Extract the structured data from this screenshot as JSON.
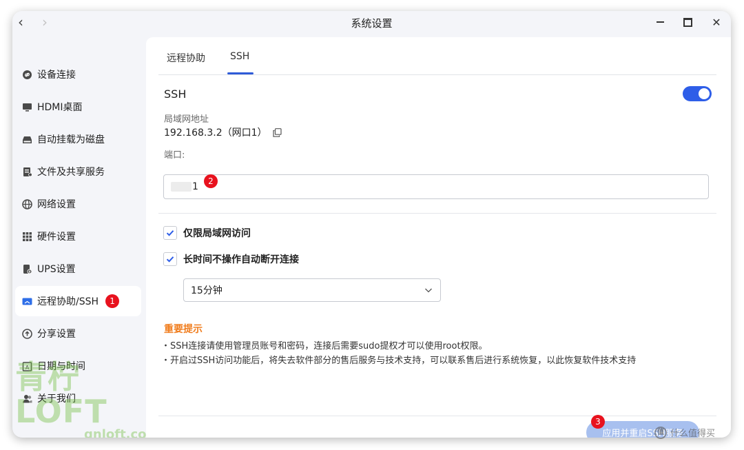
{
  "window": {
    "title": "系统设置"
  },
  "sidebar": {
    "items": [
      {
        "label": "设备连接",
        "icon": "link-icon"
      },
      {
        "label": "HDMI桌面",
        "icon": "monitor-icon"
      },
      {
        "label": "自动挂载为磁盘",
        "icon": "drive-icon"
      },
      {
        "label": "文件及共享服务",
        "icon": "file-share-icon"
      },
      {
        "label": "网络设置",
        "icon": "globe-icon"
      },
      {
        "label": "硬件设置",
        "icon": "grid-icon"
      },
      {
        "label": "UPS设置",
        "icon": "battery-icon"
      },
      {
        "label": "远程协助/SSH",
        "icon": "remote-desktop-icon",
        "badge": "1",
        "active": true
      },
      {
        "label": "分享设置",
        "icon": "share-icon"
      },
      {
        "label": "日期与时间",
        "icon": "calendar-icon"
      },
      {
        "label": "关于我们",
        "icon": "users-icon"
      }
    ]
  },
  "watermark": {
    "main": "青柠LOFT",
    "sub": "qnloft.com"
  },
  "tabs": [
    {
      "label": "远程协助"
    },
    {
      "label": "SSH",
      "active": true
    }
  ],
  "ssh": {
    "heading": "SSH",
    "enabled": true,
    "lan_label": "局域网地址",
    "lan_value": "192.168.3.2（网口1）",
    "port_label": "端口:",
    "port_value": "1",
    "port_badge": "2",
    "checkbox_lan_only": {
      "label": "仅限局域网访问",
      "checked": true
    },
    "checkbox_auto_disconnect": {
      "label": "长时间不操作自动断开连接",
      "checked": true
    },
    "timeout_select": "15分钟"
  },
  "notice": {
    "title": "重要提示",
    "lines": [
      "・SSH连接请使用管理员账号和密码，连接后需要sudo提权才可以使用root权限。",
      "・开启过SSH访问功能后，将失去软件部分的售后服务与技术支持，可以联系售后进行系统恢复，以此恢复软件技术支持"
    ]
  },
  "apply_button": {
    "label": "应用并重启SSH服务",
    "badge": "3"
  },
  "source_watermark": {
    "logo": "值",
    "text": "什么值得买"
  },
  "colors": {
    "accent": "#2e5ee8",
    "badge": "#e8121e",
    "warning": "#f07d1e",
    "button_disabled": "#a8c0ef"
  }
}
